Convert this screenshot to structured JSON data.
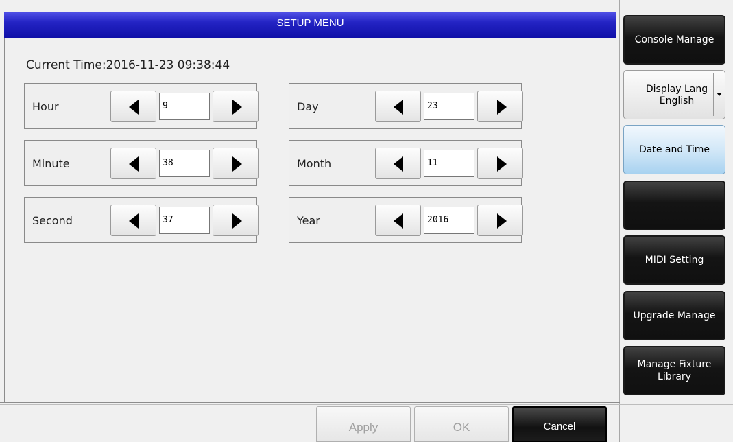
{
  "header": {
    "title": "SETUP MENU"
  },
  "current_time": {
    "label": "Current Time:",
    "value": "2016-11-23 09:38:44"
  },
  "fields": {
    "hour": {
      "label": "Hour",
      "value": "9"
    },
    "minute": {
      "label": "Minute",
      "value": "38"
    },
    "second": {
      "label": "Second",
      "value": "37"
    },
    "day": {
      "label": "Day",
      "value": "23"
    },
    "month": {
      "label": "Month",
      "value": "11"
    },
    "year": {
      "label": "Year",
      "value": "2016"
    }
  },
  "footer": {
    "apply": "Apply",
    "ok": "OK",
    "cancel": "Cancel"
  },
  "sidebar": {
    "console_manage": "Console Manage",
    "display_language": {
      "label": "Display Lang",
      "value": "English"
    },
    "date_and_time": "Date and Time",
    "blank": "",
    "midi_setting": "MIDI Setting",
    "upgrade_manage": "Upgrade Manage",
    "manage_fixture_library": "Manage Fixture Library"
  },
  "colors": {
    "title_bar": "#2424c4",
    "active_tab": "#cfe6f7",
    "dark_button": "#141414"
  }
}
